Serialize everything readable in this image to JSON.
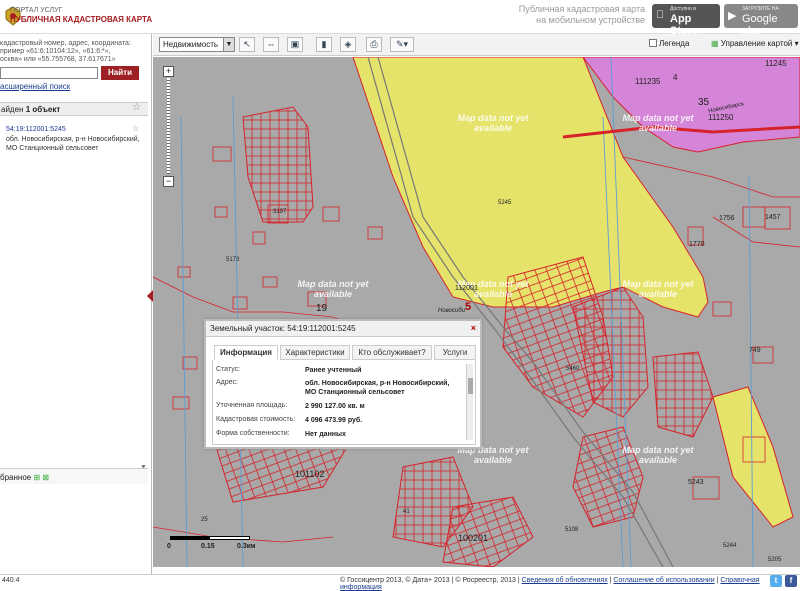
{
  "header": {
    "portal_label": "ПОРТАЛ УСЛУГ",
    "portal_title": "ПУБЛИЧНАЯ КАДАСТРОВАЯ КАРТА",
    "mobile_line1": "Публичная кадастровая карта",
    "mobile_line2": "на мобильном устройстве",
    "appstore_small": "Доступно в",
    "appstore_big": "App Store",
    "gplay_small": "ЗАГРУЗИТЕ НА",
    "gplay_big": "Google play"
  },
  "toolbar": {
    "object_type": "Недвижимость",
    "legend_label": "Легенда",
    "map_control_label": "Управление картой"
  },
  "sidebar": {
    "hint_line1": "кадастровый номер, адрес, координата:",
    "hint_line2": "пример «61:6:10104:12», «61:6:*»,",
    "hint_line3": "осква» или «55.755768, 37.617671»",
    "search_value": "",
    "find_button": "Найти",
    "advanced_search": "асширенный поиск",
    "found_prefix": "айден",
    "found_count": "1 объект",
    "result_cadastral": "54:19:112001:5245",
    "result_addr1": "обл. Новосибирская, р-н Новосибирский,",
    "result_addr2": "МО Станционный сельсовет",
    "favorites": "бранное"
  },
  "map": {
    "watermark": "Map data not yet available",
    "labels": [
      "111235",
      "11245",
      "4",
      "35",
      "Новосибирск",
      "111250",
      "5245",
      "3197",
      "5173",
      "1756",
      "1457",
      "1770",
      "112001",
      "Новосиби",
      "5",
      "19",
      "5460",
      "749",
      "5243",
      "101102",
      "100201",
      "41",
      "25",
      "5244",
      "5108",
      "5205"
    ],
    "scale_labels": [
      "0",
      "0.15",
      "0.3км"
    ]
  },
  "popup": {
    "title": "Земельный участок: 54:19:112001:5245",
    "tabs": [
      "Информация",
      "Характеристики",
      "Кто обслуживает?",
      "Услуги"
    ],
    "rows": [
      {
        "label": "Статус:",
        "value": "Ранее учтенный"
      },
      {
        "label": "Адрес:",
        "value": "обл. Новосибирская, р-н Новосибирский,",
        "value2": "МО Станционный сельсовет"
      },
      {
        "label": "Уточненная площадь:",
        "value": "2 990 127.00 кв. м"
      },
      {
        "label": "Кадастровая стоимость:",
        "value": "4 096 473.99 руб."
      },
      {
        "label": "Форма собственности:",
        "value": "Нет данных"
      }
    ]
  },
  "footer": {
    "version": "440.4",
    "copyright": "© Госсицентр 2013, © Дата+ 2013 | © Росреестр, 2013 |",
    "link1": "Сведения об обновлениях",
    "link2": "Соглашение об использовании",
    "link3": "Справочная информация"
  },
  "colors": {
    "accent": "#9d2025",
    "parcel_border": "#d6222a",
    "yellow": "#e6e36a",
    "magenta": "#d585d8"
  }
}
